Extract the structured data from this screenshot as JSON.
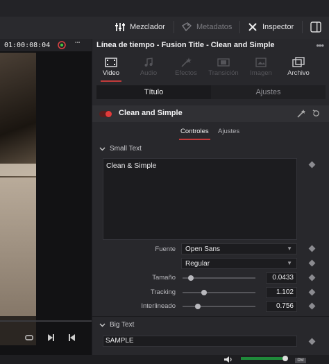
{
  "topbar": {
    "mixer_label": "Mezclador",
    "metadata_label": "Metadatos",
    "inspector_label": "Inspector"
  },
  "viewer": {
    "timecode": "01:00:08:04"
  },
  "inspector": {
    "title": "Línea de tiempo - Fusion Title - Clean and Simple",
    "tabs": [
      {
        "label": "Video",
        "icon": "video-icon",
        "active": true
      },
      {
        "label": "Audio",
        "icon": "audio-icon",
        "active": false
      },
      {
        "label": "Efectos",
        "icon": "effects-icon",
        "active": false
      },
      {
        "label": "Transición",
        "icon": "transition-icon",
        "active": false
      },
      {
        "label": "Imagen",
        "icon": "image-icon",
        "active": false
      },
      {
        "label": "Archivo",
        "icon": "file-icon",
        "active": false
      }
    ],
    "segment": {
      "title_label": "Título",
      "settings_label": "Ajustes"
    },
    "effect_name": "Clean and Simple",
    "subtabs": {
      "controls": "Controles",
      "settings": "Ajustes"
    },
    "small_text": {
      "section_label": "Small Text",
      "text_value": "Clean & Simple",
      "font_label": "Fuente",
      "font_value": "Open Sans",
      "style_value": "Regular",
      "size_label": "Tamaño",
      "size_value": "0.0433",
      "tracking_label": "Tracking",
      "tracking_value": "1.102",
      "leading_label": "Interlineado",
      "leading_value": "0.756"
    },
    "big_text": {
      "section_label": "Big Text",
      "text_value": "SAMPLE"
    }
  },
  "bottom": {
    "badge": "DM"
  },
  "colors": {
    "accent": "#c23b3b",
    "toggle_on": "#e23b3b",
    "panel_bg": "#28282c"
  }
}
